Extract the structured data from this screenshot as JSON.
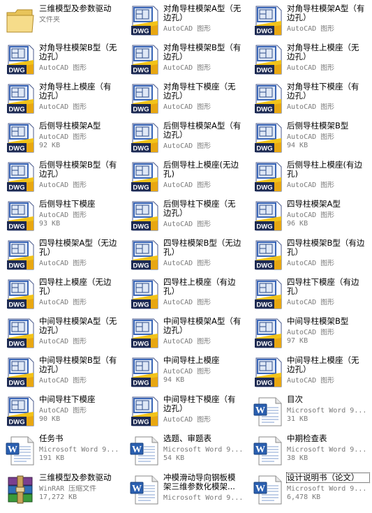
{
  "files": [
    {
      "name": "三维模型及参数驱动",
      "lines": 1,
      "type": "文件夹",
      "size": "",
      "icon": "folder-icon"
    },
    {
      "name": "对角导柱模架A型（无\n边孔）",
      "lines": 2,
      "type": "AutoCAD 图形",
      "size": "",
      "icon": "dwg-file-icon"
    },
    {
      "name": "对角导柱模架A型（有\n边孔）",
      "lines": 2,
      "type": "AutoCAD 图形",
      "size": "",
      "icon": "dwg-file-icon"
    },
    {
      "name": "对角导柱模架B型（无\n边孔）",
      "lines": 2,
      "type": "AutoCAD 图形",
      "size": "",
      "icon": "dwg-file-icon"
    },
    {
      "name": "对角导柱模架B型（有\n边孔）",
      "lines": 2,
      "type": "AutoCAD 图形",
      "size": "",
      "icon": "dwg-file-icon"
    },
    {
      "name": "对角导柱上模座（无\n边孔）",
      "lines": 2,
      "type": "AutoCAD 图形",
      "size": "",
      "icon": "dwg-file-icon"
    },
    {
      "name": "对角导柱上模座（有\n边孔）",
      "lines": 2,
      "type": "AutoCAD 图形",
      "size": "",
      "icon": "dwg-file-icon"
    },
    {
      "name": "对角导柱下模座（无\n边孔）",
      "lines": 2,
      "type": "AutoCAD 图形",
      "size": "",
      "icon": "dwg-file-icon"
    },
    {
      "name": "对角导柱下模座（有\n边孔）",
      "lines": 2,
      "type": "AutoCAD 图形",
      "size": "",
      "icon": "dwg-file-icon"
    },
    {
      "name": "后侧导柱模架A型",
      "lines": 1,
      "type": "AutoCAD 图形",
      "size": "92 KB",
      "icon": "dwg-file-icon"
    },
    {
      "name": "后侧导柱模架A型（有\n边孔）",
      "lines": 2,
      "type": "AutoCAD 图形",
      "size": "",
      "icon": "dwg-file-icon"
    },
    {
      "name": "后侧导柱模架B型",
      "lines": 1,
      "type": "AutoCAD 图形",
      "size": "94 KB",
      "icon": "dwg-file-icon"
    },
    {
      "name": "后侧导柱模架B型（有\n边孔）",
      "lines": 2,
      "type": "AutoCAD 图形",
      "size": "",
      "icon": "dwg-file-icon"
    },
    {
      "name": "后侧导柱上模座(无边\n孔)",
      "lines": 2,
      "type": "AutoCAD 图形",
      "size": "",
      "icon": "dwg-file-icon"
    },
    {
      "name": "后侧导柱上模座(有边\n孔)",
      "lines": 2,
      "type": "AutoCAD 图形",
      "size": "",
      "icon": "dwg-file-icon"
    },
    {
      "name": "后侧导柱下模座",
      "lines": 1,
      "type": "AutoCAD 图形",
      "size": "93 KB",
      "icon": "dwg-file-icon"
    },
    {
      "name": "后侧导柱下模座（无\n边孔）",
      "lines": 2,
      "type": "AutoCAD 图形",
      "size": "",
      "icon": "dwg-file-icon"
    },
    {
      "name": "四导柱模架A型",
      "lines": 1,
      "type": "AutoCAD 图形",
      "size": "96 KB",
      "icon": "dwg-file-icon"
    },
    {
      "name": "四导柱模架A型（无边\n孔）",
      "lines": 2,
      "type": "AutoCAD 图形",
      "size": "",
      "icon": "dwg-file-icon"
    },
    {
      "name": "四导柱模架B型（无边\n孔）",
      "lines": 2,
      "type": "AutoCAD 图形",
      "size": "",
      "icon": "dwg-file-icon"
    },
    {
      "name": "四导柱模架B型（有边\n孔）",
      "lines": 2,
      "type": "AutoCAD 图形",
      "size": "",
      "icon": "dwg-file-icon"
    },
    {
      "name": "四导柱上模座（无边\n孔）",
      "lines": 2,
      "type": "AutoCAD 图形",
      "size": "",
      "icon": "dwg-file-icon"
    },
    {
      "name": "四导柱上模座（有边\n孔）",
      "lines": 2,
      "type": "AutoCAD 图形",
      "size": "",
      "icon": "dwg-file-icon"
    },
    {
      "name": "四导柱下模座（有边\n孔）",
      "lines": 2,
      "type": "AutoCAD 图形",
      "size": "",
      "icon": "dwg-file-icon"
    },
    {
      "name": "中间导柱模架A型（无\n边孔）",
      "lines": 2,
      "type": "AutoCAD 图形",
      "size": "",
      "icon": "dwg-file-icon"
    },
    {
      "name": "中间导柱模架A型（有\n边孔）",
      "lines": 2,
      "type": "AutoCAD 图形",
      "size": "",
      "icon": "dwg-file-icon"
    },
    {
      "name": "中间导柱模架B型",
      "lines": 1,
      "type": "AutoCAD 图形",
      "size": "97 KB",
      "icon": "dwg-file-icon"
    },
    {
      "name": "中间导柱模架B型（有\n边孔）",
      "lines": 2,
      "type": "AutoCAD 图形",
      "size": "",
      "icon": "dwg-file-icon"
    },
    {
      "name": "中间导柱上模座",
      "lines": 1,
      "type": "AutoCAD 图形",
      "size": "94 KB",
      "icon": "dwg-file-icon"
    },
    {
      "name": "中间导柱上模座（无\n边孔）",
      "lines": 2,
      "type": "AutoCAD 图形",
      "size": "",
      "icon": "dwg-file-icon"
    },
    {
      "name": "中间导柱下模座",
      "lines": 1,
      "type": "AutoCAD 图形",
      "size": "90 KB",
      "icon": "dwg-file-icon"
    },
    {
      "name": "中间导柱下模座（有\n边孔）",
      "lines": 2,
      "type": "AutoCAD 图形",
      "size": "",
      "icon": "dwg-file-icon"
    },
    {
      "name": "目次",
      "lines": 1,
      "type": "Microsoft Word 9...",
      "size": "31 KB",
      "icon": "word-doc-icon"
    },
    {
      "name": "任务书",
      "lines": 1,
      "type": "Microsoft Word 9...",
      "size": "191 KB",
      "icon": "word-doc-icon"
    },
    {
      "name": "选题、审题表",
      "lines": 1,
      "type": "Microsoft Word 9...",
      "size": "54 KB",
      "icon": "word-doc-icon"
    },
    {
      "name": "中期检查表",
      "lines": 1,
      "type": "Microsoft Word 9...",
      "size": "38 KB",
      "icon": "word-doc-icon"
    },
    {
      "name": "三维模型及参数驱动",
      "lines": 1,
      "type": "WinRAR 压缩文件",
      "size": "17,272 KB",
      "icon": "winrar-archive-icon"
    },
    {
      "name": "冲模滑动导向钢板模\n架三维参数化模架...",
      "lines": 2,
      "type": "Microsoft Word 9...",
      "size": "",
      "icon": "word-doc-icon"
    },
    {
      "name": "设计说明书（论文）",
      "lines": 1,
      "type": "Microsoft Word 9...",
      "size": "6,478 KB",
      "icon": "word-doc-icon",
      "selected": true
    }
  ]
}
